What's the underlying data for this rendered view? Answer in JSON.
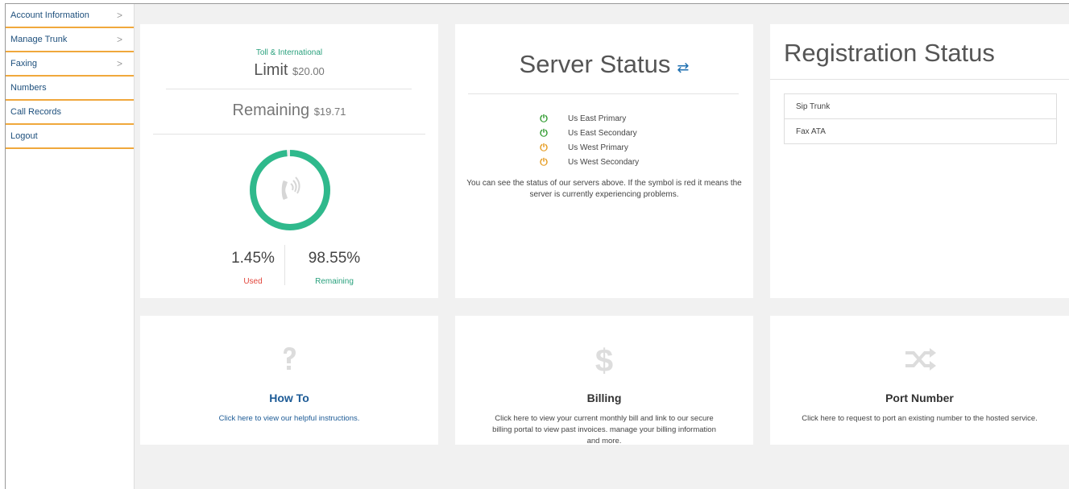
{
  "sidebar": {
    "items": [
      {
        "label": "Account Information",
        "chevron": ">"
      },
      {
        "label": "Manage Trunk",
        "chevron": ">"
      },
      {
        "label": "Faxing",
        "chevron": ">"
      },
      {
        "label": "Numbers"
      },
      {
        "label": "Call Records"
      },
      {
        "label": "Logout"
      }
    ]
  },
  "usage": {
    "caption": "Toll & International",
    "limit_label": "Limit",
    "limit_amount": "$20.00",
    "remaining_label": "Remaining",
    "remaining_amount": "$19.71",
    "used_pct": "1.45%",
    "used_label": "Used",
    "remaining_pct": "98.55%",
    "remaining_pct_label": "Remaining",
    "remaining_fraction": 0.9855,
    "ring_color": "#2fb98c",
    "icon": "phone-ringing-icon"
  },
  "server": {
    "title": "Server Status",
    "refresh_icon": "refresh-icon",
    "servers": [
      {
        "name": "Us East Primary",
        "status_color": "#2e9a2e"
      },
      {
        "name": "Us East Secondary",
        "status_color": "#2e9a2e"
      },
      {
        "name": "Us West Primary",
        "status_color": "#e59a1d"
      },
      {
        "name": "Us West Secondary",
        "status_color": "#e59a1d"
      }
    ],
    "note": "You can see the status of our servers above. If the symbol is red it means the server is currently experiencing problems."
  },
  "registration": {
    "title": "Registration Status",
    "items": [
      "Sip Trunk",
      "Fax ATA"
    ]
  },
  "tiles": {
    "howto": {
      "icon": "question-icon",
      "title": "How To",
      "desc": "Click here to view our helpful instructions.",
      "color": "#1d5b96"
    },
    "billing": {
      "icon": "dollar-icon",
      "title": "Billing",
      "desc": "Click here to view your current monthly bill and link to our secure billing portal to view past invoices. manage your billing information and more.",
      "color": "#333333"
    },
    "port": {
      "icon": "shuffle-icon",
      "title": "Port Number",
      "desc": "Click here to request to port an existing number to the hosted service.",
      "color": "#333333"
    }
  }
}
